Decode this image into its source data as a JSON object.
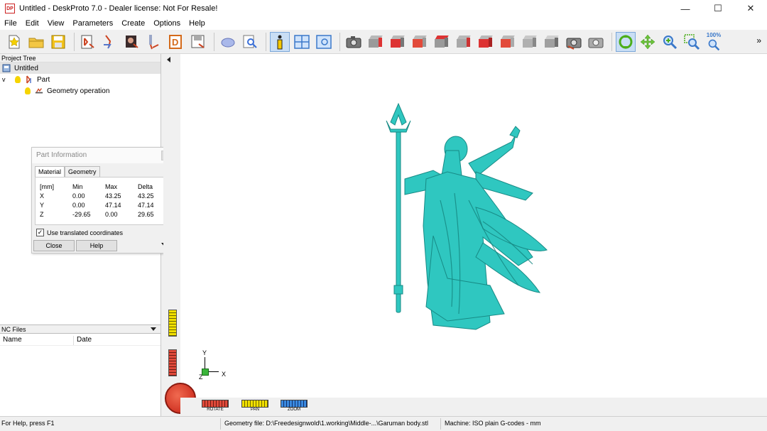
{
  "titlebar": {
    "app_icon_text": "DP",
    "title": "Untitled - DeskProto 7.0 - Dealer license: Not For Resale!",
    "minimize": "—",
    "maximize": "☐",
    "close": "✕"
  },
  "menu": [
    "File",
    "Edit",
    "View",
    "Parameters",
    "Create",
    "Options",
    "Help"
  ],
  "toolbar": {
    "zoom_label": "100%",
    "more": "»",
    "icons": [
      "new-project",
      "open-project",
      "save-project",
      "part-geometry",
      "vector-geometry",
      "bitmap-geometry",
      "drawing",
      "dxf-geometry",
      "save-as",
      "shading",
      "find",
      "part-info",
      "layout-views",
      "view-options",
      "camera",
      "view-front",
      "view-back",
      "view-left",
      "view-right",
      "view-top",
      "view-bottom",
      "view-iso-1",
      "view-iso-2",
      "screenshot",
      "print-preview",
      "rotate-view",
      "pan-view",
      "zoom-in",
      "zoom-window",
      "zoom-100"
    ]
  },
  "project_tree": {
    "header": "Project Tree",
    "root": "Untitled",
    "part": "Part",
    "operation": "Geometry operation",
    "expand_glyph": "v"
  },
  "part_info": {
    "title": "Part Information",
    "tabs": [
      "Material",
      "Geometry"
    ],
    "headers": [
      "[mm]",
      "Min",
      "Max",
      "Delta"
    ],
    "rows": [
      [
        "X",
        "0.00",
        "43.25",
        "43.25"
      ],
      [
        "Y",
        "0.00",
        "47.14",
        "47.14"
      ],
      [
        "Z",
        "-29.65",
        "0.00",
        "29.65"
      ]
    ],
    "checkbox_label": "Use translated coordinates",
    "checkbox_checked": true,
    "checkbox_mark": "✓",
    "close_button": "Close",
    "help_button": "Help"
  },
  "nc_files": {
    "header": "NC Files",
    "columns": [
      "Name",
      "Date"
    ]
  },
  "viewport": {
    "model_color": "#2fc7c0",
    "axes": {
      "y": "Y",
      "x": "X",
      "z": "Z"
    },
    "wheels": [
      "ROTATE",
      "PAN",
      "ZOOM"
    ]
  },
  "status": {
    "help": "For Help, press F1",
    "geometry": "Geometry file: D:\\Freedesignwold\\1.working\\Middle-...\\Garuman body.stl",
    "machine": "Machine: ISO plain G-codes - mm"
  }
}
